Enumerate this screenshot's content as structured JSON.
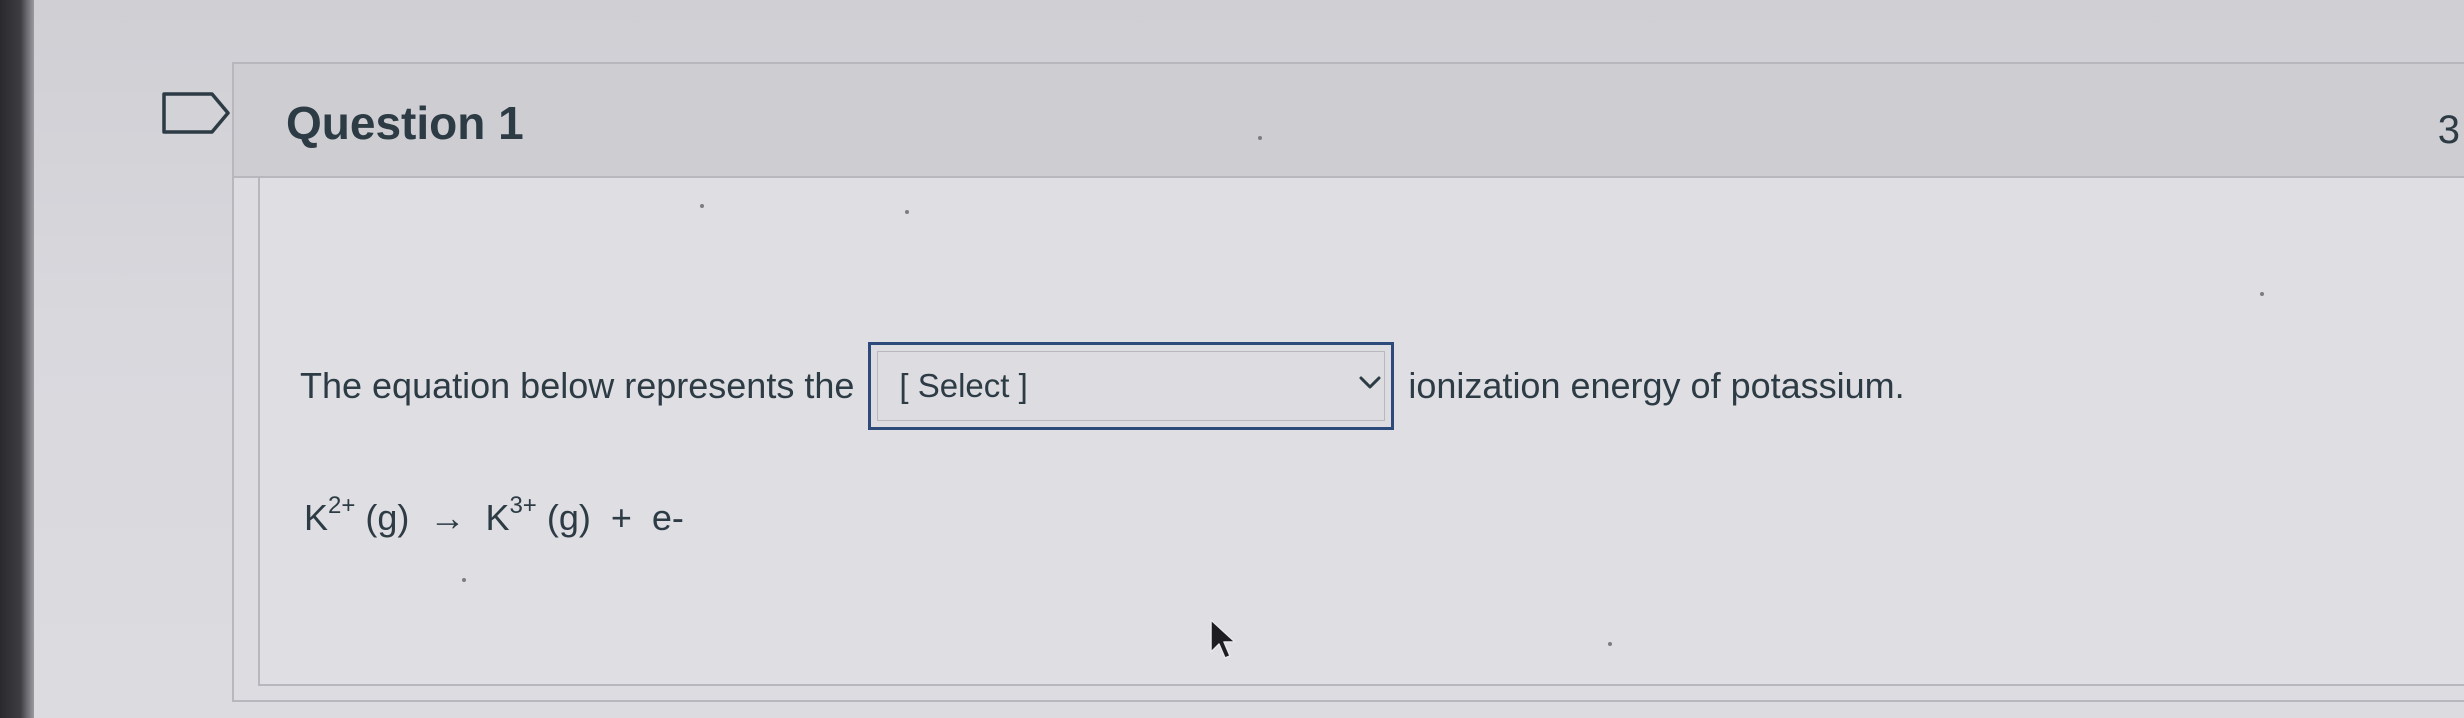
{
  "question": {
    "title": "Question 1",
    "points_fragment": "3",
    "text_before": "The equation below represents the",
    "text_after": "ionization energy of potassium.",
    "select": {
      "selected": "[ Select ]"
    },
    "equation": {
      "reactant_symbol": "K",
      "reactant_charge": "2+",
      "reactant_state": "(g)",
      "arrow": "→",
      "product_symbol": "K",
      "product_charge": "3+",
      "product_state": "(g)",
      "plus": "+",
      "electron": "e-"
    }
  },
  "icons": {
    "flag": "flag-outline-icon",
    "select_arrow": "chevron-down-icon",
    "cursor": "mouse-pointer-icon"
  },
  "colors": {
    "select_border": "#2c4a7a",
    "text": "#2d3b45",
    "header_bg": "#cdcdd2"
  }
}
